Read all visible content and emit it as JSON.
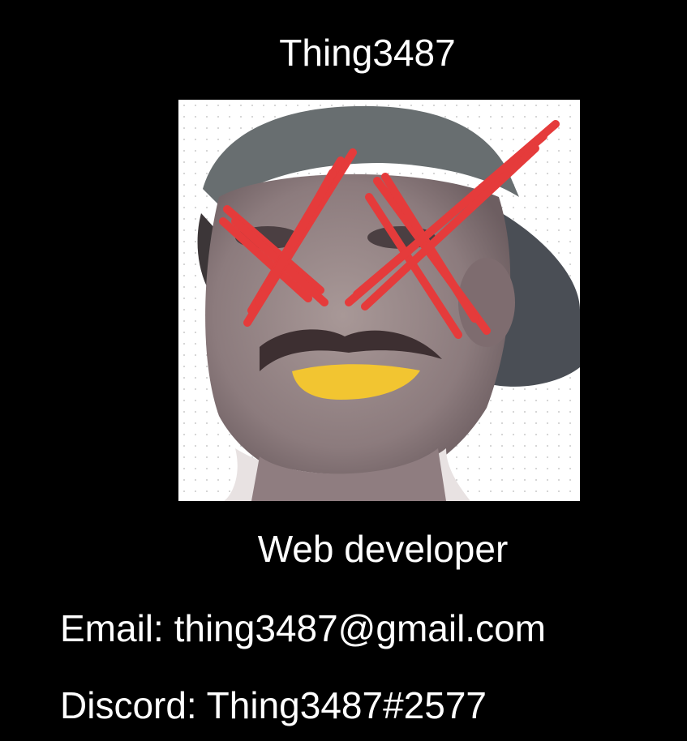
{
  "profile": {
    "username": "Thing3487",
    "role": "Web developer",
    "email_label": "Email:",
    "email": "thing3487@gmail.com",
    "discord_label": "Discord:",
    "discord": "Thing3487#2577"
  },
  "colors": {
    "background": "#000000",
    "text": "#ffffff",
    "x_marks": "#e53b3b",
    "teeth": "#f2c531"
  },
  "avatar": {
    "icon": "doodled-face-photo"
  }
}
